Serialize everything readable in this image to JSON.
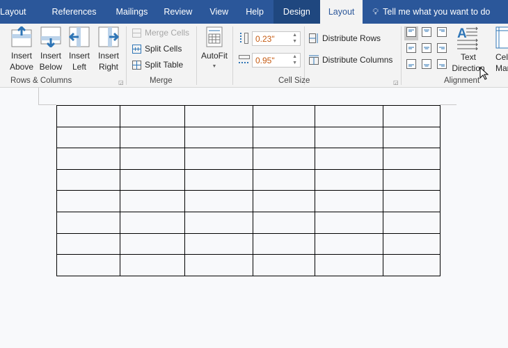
{
  "tabs": [
    "Layout",
    "References",
    "Mailings",
    "Review",
    "View",
    "Help",
    "Design",
    "Layout"
  ],
  "tell_me": "Tell me what you want to do",
  "rows_columns": {
    "insert_above": [
      "Insert",
      "Above"
    ],
    "insert_below": [
      "Insert",
      "Below"
    ],
    "insert_left": [
      "Insert",
      "Left"
    ],
    "insert_right": [
      "Insert",
      "Right"
    ],
    "label": "Rows & Columns"
  },
  "merge": {
    "merge_cells": "Merge Cells",
    "split_cells": "Split Cells",
    "split_table": "Split Table",
    "label": "Merge"
  },
  "cell_size": {
    "autofit": "AutoFit",
    "height": "0.23\"",
    "width": "0.95\"",
    "distribute_rows": "Distribute Rows",
    "distribute_columns": "Distribute Columns",
    "label": "Cell Size"
  },
  "alignment": {
    "text_direction": [
      "Text",
      "Direction"
    ],
    "cell_margins": [
      "Cell",
      "Margins"
    ],
    "label": "Alignment"
  },
  "table": {
    "rows": 8,
    "columns": 6
  }
}
